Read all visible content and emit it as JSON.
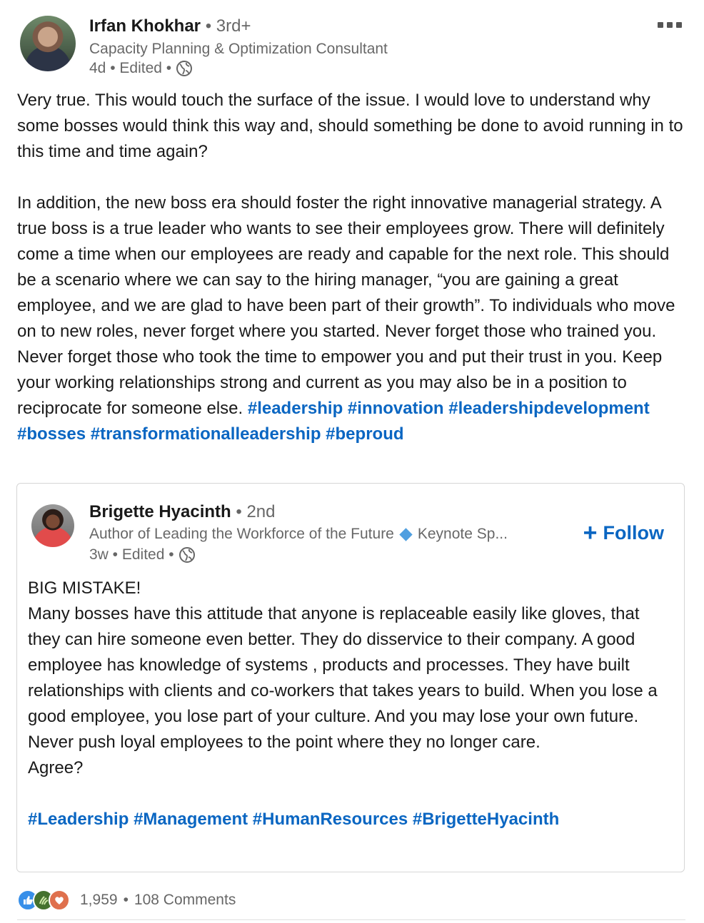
{
  "post": {
    "author": {
      "name": "Irfan Khokhar",
      "degree": "• 3rd+",
      "headline": "Capacity Planning & Optimization Consultant",
      "meta": "4d • Edited •"
    },
    "paragraph1": "Very true. This would touch the surface of the issue. I would love to understand why some bosses would think this way and, should something be done to avoid running in to this time and time again?",
    "paragraph2": "In addition, the new boss era should foster the right innovative managerial strategy. A true boss is a true leader who wants to see their employees grow. There will definitely come a time when our employees are ready and capable for the next role. This should be a scenario where we can say to the hiring manager, “you are gaining a great employee, and we are glad to have been part of their growth”. To individuals who move on to new roles, never forget where you started. Never forget those who trained you. Never forget those who took the time to empower you and put their trust in you. Keep your working relationships strong and current as you may also be in a position to reciprocate for someone else.",
    "hashtags": [
      "#leadership",
      "#innovation",
      "#leadershipdevelopment",
      "#bosses",
      "#transformationalleadership",
      "#beproud"
    ]
  },
  "shared": {
    "author": {
      "name": "Brigette Hyacinth",
      "degree": "• 2nd",
      "headline_a": "Author of Leading the Workforce of the Future",
      "headline_b": "Keynote Sp...",
      "meta": "3w • Edited •"
    },
    "follow_label": "Follow",
    "body": "BIG MISTAKE!\nMany bosses have this attitude that anyone is replaceable easily like gloves, that they can hire someone even better. They do disservice to their company. A good employee has knowledge of systems , products and processes. They have built relationships with clients and co-workers that takes years to build. When you lose a good employee, you lose part of your culture. And you may lose your own future. Never push loyal employees to the point where they no longer care.\nAgree?",
    "hashtags": [
      "#Leadership",
      "#Management",
      "#HumanResources",
      "#BrigetteHyacinth"
    ]
  },
  "social": {
    "reaction_icons": [
      "like-icon",
      "celebrate-icon",
      "love-icon"
    ],
    "reaction_count": "1,959",
    "separator": "•",
    "comments": "108 Comments"
  },
  "colors": {
    "link": "#0a66c2",
    "secondary_text": "#666666",
    "like": "#378fe9",
    "celebrate": "#44712e",
    "love": "#df704d"
  }
}
